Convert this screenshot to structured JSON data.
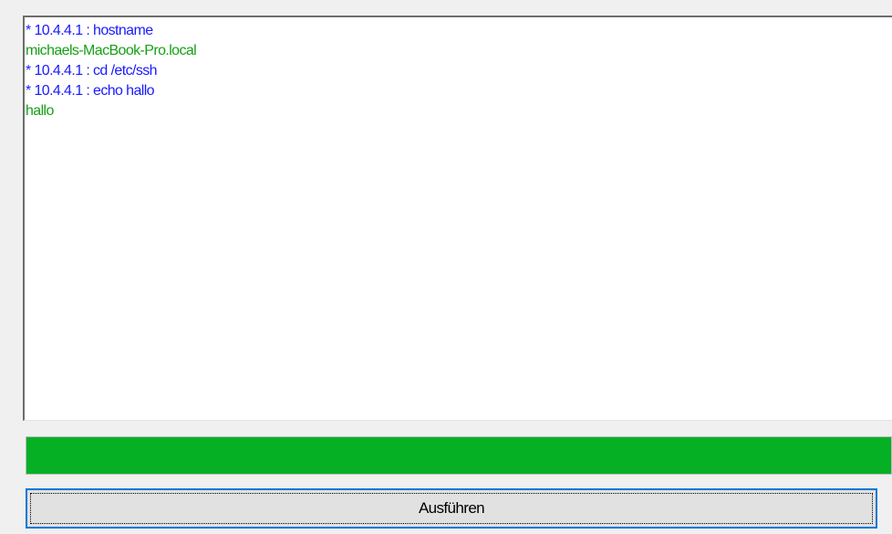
{
  "console": {
    "lines": [
      {
        "text": "* 10.4.4.1 : hostname",
        "color": "#1a1aff"
      },
      {
        "text": "michaels-MacBook-Pro.local",
        "color": "#16a016"
      },
      {
        "text": "* 10.4.4.1 : cd /etc/ssh",
        "color": "#1a1aff"
      },
      {
        "text": "* 10.4.4.1 : echo hallo",
        "color": "#1a1aff"
      },
      {
        "text": "hallo",
        "color": "#16a016"
      }
    ]
  },
  "progress": {
    "value_percent": 100,
    "color": "#06b025"
  },
  "actions": {
    "run_label": "Ausführen"
  }
}
